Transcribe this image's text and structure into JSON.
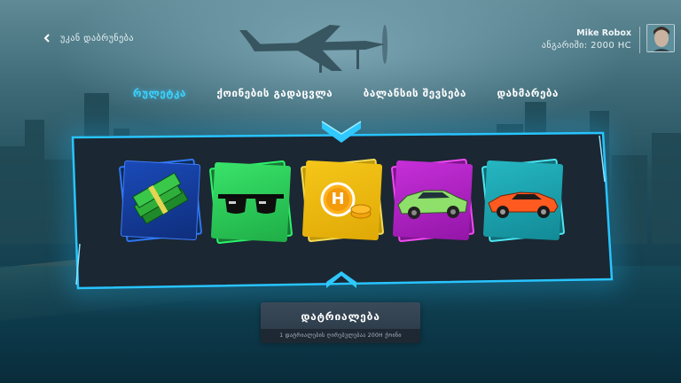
{
  "header": {
    "back_label": "უკან დაბრუნება",
    "user_name": "Mike Robox",
    "balance_text": "ანგარიში: 2000 HC"
  },
  "tabs": [
    {
      "label": "რულეტკა",
      "active": true
    },
    {
      "label": "ქოინების გადაცვლა",
      "active": false
    },
    {
      "label": "ბალანსის შევსება",
      "active": false
    },
    {
      "label": "დახმარება",
      "active": false
    }
  ],
  "roulette": {
    "accent_color": "#2fc8ff",
    "items": [
      {
        "name": "cash-stack",
        "frame_color": "#2f7bff"
      },
      {
        "name": "sunglasses",
        "frame_color": "#2cff6d"
      },
      {
        "name": "hc-coin",
        "frame_color": "#ffe55a",
        "coin_letter": "H"
      },
      {
        "name": "green-sports-car",
        "frame_color": "#ff4cff"
      },
      {
        "name": "orange-supercar",
        "frame_color": "#4ef2ff"
      }
    ]
  },
  "open_button": {
    "label": "დატრიალება",
    "sub_label": "1 დატრიალების ღირებულებაა 200H ქოინი"
  }
}
